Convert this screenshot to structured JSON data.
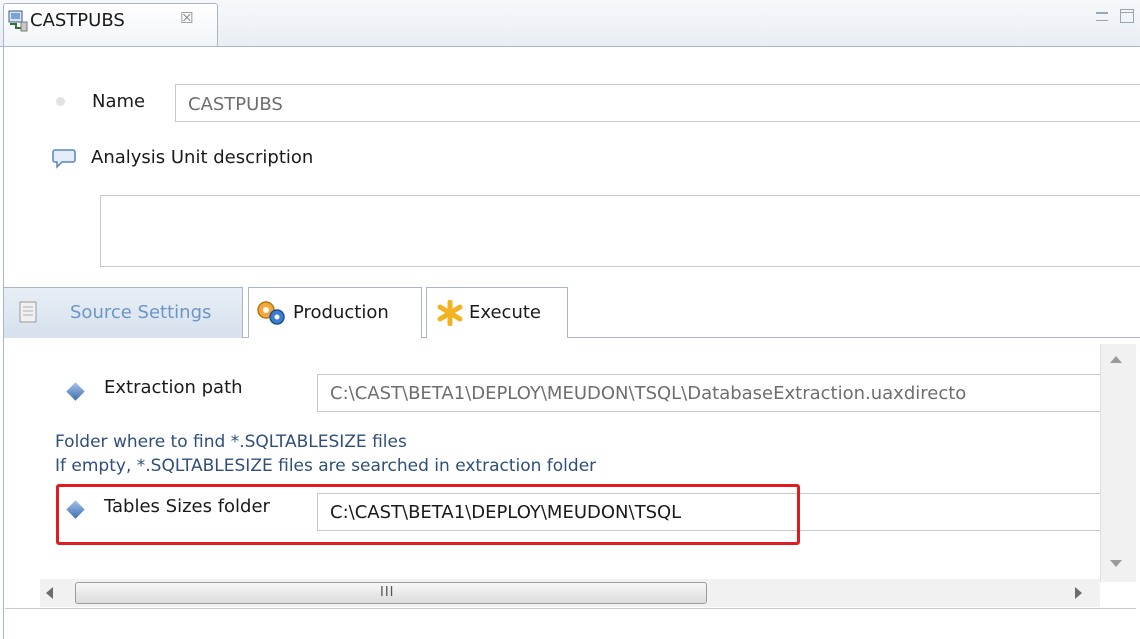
{
  "editor_tab": {
    "title": "CASTPUBS",
    "close_symbol": "☒"
  },
  "form": {
    "name_label": "Name",
    "name_value": "CASTPUBS",
    "description_label": "Analysis Unit description",
    "description_value": ""
  },
  "tabs": [
    {
      "label": "Source Settings",
      "icon": "document-icon",
      "active": true
    },
    {
      "label": "Production",
      "icon": "gears-icon",
      "active": false
    },
    {
      "label": "Execute",
      "icon": "asterisk-icon",
      "active": false
    }
  ],
  "source_settings": {
    "extraction_path_label": "Extraction path",
    "extraction_path_value": "C:\\CAST\\BETA1\\DEPLOY\\MEUDON\\TSQL\\DatabaseExtraction.uaxdirecto",
    "hint_line_1": "Folder where to find *.SQLTABLESIZE files",
    "hint_line_2": "If empty, *.SQLTABLESIZE files are searched in extraction folder",
    "tables_sizes_label": "Tables Sizes folder",
    "tables_sizes_value": "C:\\CAST\\BETA1\\DEPLOY\\MEUDON\\TSQL"
  },
  "scrollbar": {
    "grip": "III"
  },
  "colors": {
    "highlight": "#e01b22",
    "active_tab_text": "#6e95c5",
    "hint_text": "#2f4f7a"
  }
}
